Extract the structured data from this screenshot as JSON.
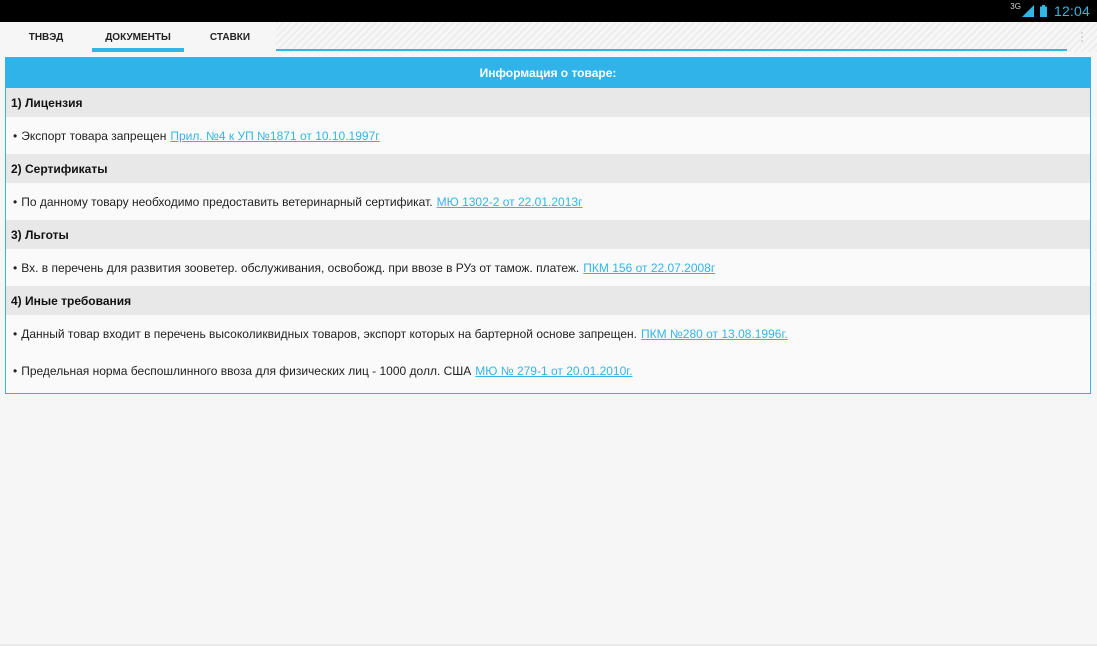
{
  "status_bar": {
    "network": "3G",
    "time": "12:04",
    "icons": [
      "signal-icon",
      "battery-icon"
    ],
    "accent_color": "#33b5e5"
  },
  "tabs": [
    {
      "label": "ТНВЭД",
      "active": false
    },
    {
      "label": "ДОКУМЕНТЫ",
      "active": true
    },
    {
      "label": "СТАВКИ",
      "active": false
    }
  ],
  "panel": {
    "header": "Информация о товаре:",
    "sections": [
      {
        "title": "1) Лицензия",
        "items": [
          {
            "text": "Экспорт товара запрещен",
            "link": "Прил. №4 к УП №1871 от 10.10.1997г"
          }
        ]
      },
      {
        "title": "2) Сертификаты",
        "items": [
          {
            "text": "По данному товару необходимо предоставить ветеринарный сертификат.",
            "link": "МЮ 1302-2 от 22.01.2013г"
          }
        ]
      },
      {
        "title": "3) Льготы",
        "items": [
          {
            "text": "Вх. в перечень для развития зооветер. обслуживания, освобожд. при ввозе в РУз от тамож. платеж.",
            "link": "ПКМ 156 от 22.07.2008г"
          }
        ]
      },
      {
        "title": "4) Иные требования",
        "items": [
          {
            "text": "Данный товар входит в перечень высоколиквидных товаров, экспорт которых на бартерной основе запрещен.",
            "link": "ПКМ №280 от 13.08.1996г."
          },
          {
            "text": "Предельная норма беспошлинного ввоза для физических лиц - 1000 долл. США",
            "link": "МЮ № 279-1 от 20.01.2010г."
          }
        ]
      }
    ]
  },
  "bullet": "•"
}
